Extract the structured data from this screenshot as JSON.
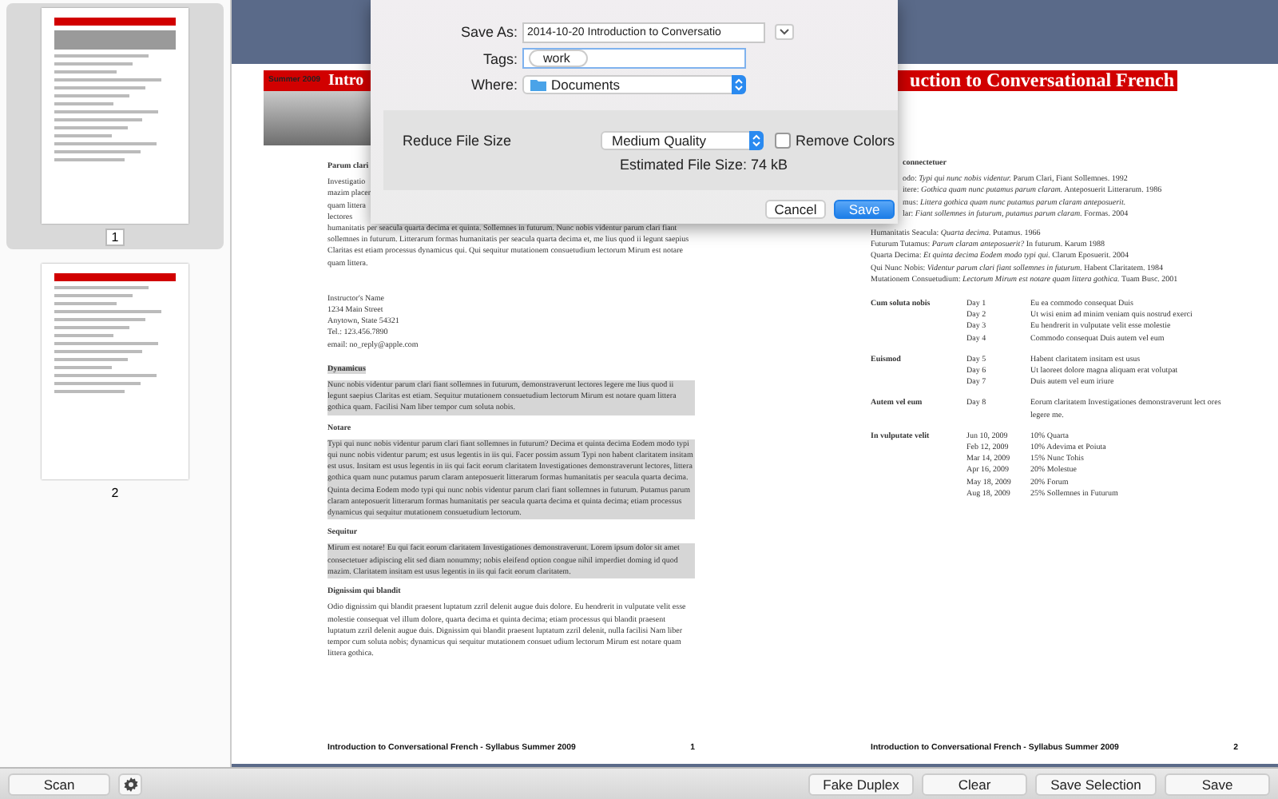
{
  "sidebar": {
    "pages": [
      {
        "label": "1",
        "selected": true
      },
      {
        "label": "2",
        "selected": false
      }
    ]
  },
  "page_1": {
    "banner_tag": "Summer 2009",
    "banner_title": "Intro",
    "cut_heading": "Parum clari",
    "cut_lines": [
      "Investigatio",
      "mazim placer",
      "quam littera",
      "lectores"
    ],
    "intro_tail": "humanitatis per seacula quarta decima et quinta. Sollemnes in futurum. Nunc nobis videntur parum clari fiant sollemnes in futurum. Litterarum formas humanitatis per seacula quarta decima et, me lius quod ii legunt saepius Claritas est etiam processus dynamicus qui. Qui sequitur mutationem consuetudium lectorum Mirum est notare quam littera.",
    "address": [
      "Instructor's Name",
      "1234 Main Street",
      "Anytown, State 54321",
      "Tel.: 123.456.7890",
      "email: no_reply@apple.com"
    ],
    "sections": [
      {
        "heading": "Dynamicus",
        "heading_highlighted": true,
        "highlighted": true,
        "text": "Nunc nobis videntur parum clari fiant sollemnes in futurum, demonstraverunt lectores legere me lius quod ii legunt saepius Claritas est etiam. Sequitur mutationem consuetudium lectorum Mirum est notare quam littera gothica quam. Facilisi Nam liber tempor cum soluta nobis."
      },
      {
        "heading": "Notare",
        "heading_highlighted": false,
        "highlighted": true,
        "text": "Typi qui nunc nobis videntur parum clari fiant sollemnes in futurum? Decima et quinta decima Eodem modo typi qui nunc nobis videntur parum; est usus legentis in iis qui. Facer possim assum Typi non habent claritatem insitam est usus. Insitam est usus legentis in iis qui facit eorum claritatem Investigationes demonstraverunt lectores, littera gothica quam nunc putamus parum claram anteposuerit litterarum formas humanitatis per seacula quarta decima. Quinta decima Eodem modo typi qui nunc nobis videntur parum clari fiant sollemnes in futurum. Putamus parum claram anteposuerit litterarum formas humanitatis per seacula quarta decima et quinta decima; etiam processus dynamicus qui sequitur mutationem consuetudium lectorum."
      },
      {
        "heading": "Sequitur",
        "heading_highlighted": false,
        "highlighted": true,
        "text": "Mirum est notare! Eu qui facit eorum claritatem Investigationes demonstraverunt. Lorem ipsum dolor sit amet consectetuer adipiscing elit sed diam nonummy; nobis eleifend option congue nihil imperdiet doming id quod mazim. Claritatem insitam est usus legentis in iis qui facit eorum claritatem."
      },
      {
        "heading": "Dignissim qui blandit",
        "heading_highlighted": false,
        "highlighted": false,
        "text": "Odio dignissim qui blandit praesent luptatum zzril delenit augue duis dolore. Eu hendrerit in vulputate velit esse molestie consequat vel illum dolore, quarta decima et quinta decima; etiam processus qui blandit praesent luptatum zzril delenit augue duis. Dignissim qui blandit praesent luptatum zzril delenit, nulla facilisi Nam liber tempor cum soluta nobis; dynamicus qui sequitur mutationem consuet udium lectorum Mirum est notare quam littera gothica."
      }
    ],
    "footer": {
      "title": "Introduction to Conversational French - Syllabus Summer 2009",
      "number": "1"
    }
  },
  "page_2": {
    "banner_title": "uction to Conversational French",
    "cut_heading": "connectetuer",
    "lines": [
      {
        "kind": "cut",
        "text": "odo: *Typi qui nunc nobis videntur.* Parum Clari, Fiant Sollemnes. 1992"
      },
      {
        "kind": "cut",
        "text": "itere: *Gothica quam nunc putamus parum claram.* Anteposuerit Litterarum. 1986"
      },
      {
        "kind": "cut",
        "text": "mus: *Littera gothica quam nunc putamus parum claram anteposuerit.*"
      },
      {
        "kind": "cut",
        "text": "lar: *Fiant sollemnes in futurum, putamus parum claram.* Formas. 2004"
      },
      {
        "kind": "full",
        "text": "Humanitatis Seacula: *Quarta decima.* Putamus. 1966"
      },
      {
        "kind": "full",
        "text": "Futurum Tutamus: *Parum claram anteposuerit?* In futurum. Karum 1988"
      },
      {
        "kind": "full",
        "text": "Quarta Decima: *Et quinta decima Eodem modo typi qui.* Clarum Eposuerit. 2004"
      },
      {
        "kind": "full",
        "text": "Qui Nunc Nobis: *Videntur parum clari fiant sollemnes in futurum.* Habent Claritatem. 1984"
      },
      {
        "kind": "full",
        "text": "Mutationem Consuetudium: *Lectorum Mirum est notare quam littera gothica.* Tuam Busc. 2001"
      }
    ],
    "schedule": [
      {
        "label": "Cum soluta nobis",
        "entries": [
          {
            "when": "Day 1",
            "what": "Eu ea commodo consequat Duis"
          },
          {
            "when": "Day 2",
            "what": "Ut wisi enim ad minim veniam quis nostrud exerci"
          },
          {
            "when": "Day 3",
            "what": "Eu hendrerit in vulputate velit esse molestie"
          },
          {
            "when": "Day 4",
            "what": "Commodo consequat Duis autem vel eum"
          }
        ]
      },
      {
        "label": "Euismod",
        "entries": [
          {
            "when": "Day 5",
            "what": "Habent claritatem insitam est usus"
          },
          {
            "when": "Day 6",
            "what": "Ut laoreet dolore magna aliquam erat volutpat"
          },
          {
            "when": "Day 7",
            "what": "Duis autem vel eum iriure"
          }
        ]
      },
      {
        "label": "Autem vel eum",
        "entries": [
          {
            "when": "Day 8",
            "what": "Eorum claritatem Investigationes demonstraverunt lect ores legere me."
          }
        ]
      },
      {
        "label": "In vulputate velit",
        "entries": [
          {
            "when": "Jun 10, 2009",
            "what": "10% Quarta"
          },
          {
            "when": "Feb 12, 2009",
            "what": "10% Adevima et Poiuta"
          },
          {
            "when": "Mar 14, 2009",
            "what": "15% Nunc Tohis"
          },
          {
            "when": "Apr 16, 2009",
            "what": "20% Molestue"
          },
          {
            "when": "May 18, 2009",
            "what": "20% Forum"
          },
          {
            "when": "Aug 18, 2009",
            "what": "25% Sollemnes in Futurum"
          }
        ]
      }
    ],
    "footer": {
      "title": "Introduction to Conversational French - Syllabus Summer 2009",
      "number": "2"
    }
  },
  "dialog": {
    "save_as_label": "Save As:",
    "save_as_value": "2014-10-20 Introduction to Conversatio",
    "tags_label": "Tags:",
    "tags": [
      "work"
    ],
    "where_label": "Where:",
    "where_value": "Documents",
    "filter_label": "Reduce File Size",
    "filter_value": "Medium Quality",
    "remove_colors": {
      "label": "Remove Colors",
      "checked": false
    },
    "estimate": "Estimated File Size: 74 kB",
    "buttons": [
      {
        "label": "Cancel",
        "kind": "normal"
      },
      {
        "label": "Save",
        "kind": "default"
      }
    ]
  },
  "toolbar": {
    "left": [
      {
        "kind": "text",
        "label": "Scan"
      },
      {
        "kind": "gear"
      }
    ],
    "right": [
      "Fake Duplex",
      "Clear",
      "Save Selection",
      "Save"
    ]
  }
}
